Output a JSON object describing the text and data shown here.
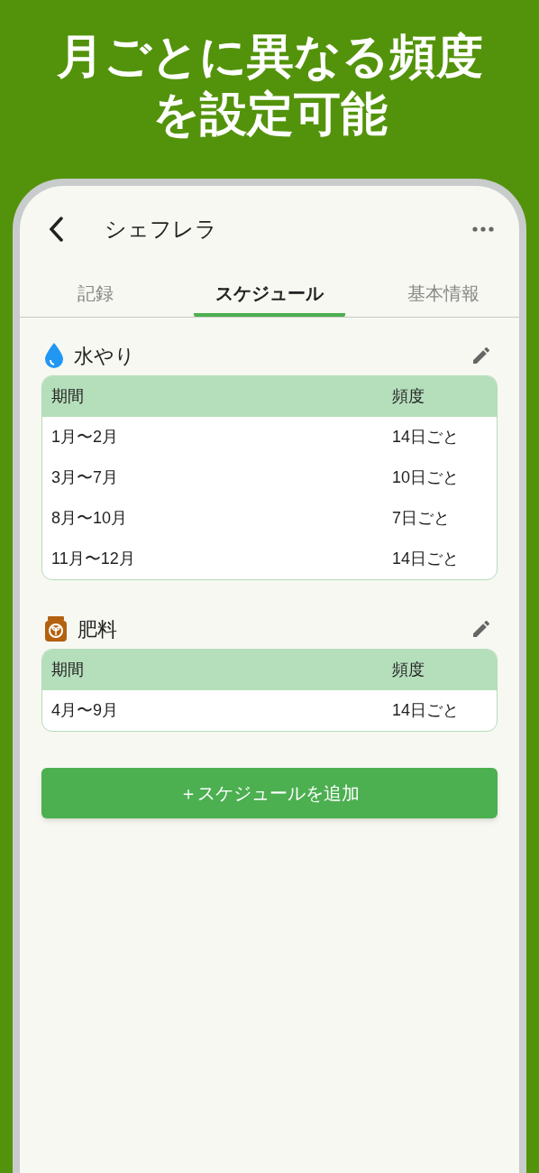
{
  "headline": [
    "月ごとに異なる頻度",
    "を設定可能"
  ],
  "app_bar": {
    "title": "シェフレラ"
  },
  "tabs": [
    {
      "label": "記録",
      "selected": false
    },
    {
      "label": "スケジュール",
      "selected": true
    },
    {
      "label": "基本情報",
      "selected": false
    }
  ],
  "sections": [
    {
      "kind": "water",
      "title": "水やり",
      "columns": [
        "期間",
        "頻度"
      ],
      "rows": [
        [
          "1月〜2月",
          "14日ごと"
        ],
        [
          "3月〜7月",
          "10日ごと"
        ],
        [
          "8月〜10月",
          "7日ごと"
        ],
        [
          "11月〜12月",
          "14日ごと"
        ]
      ]
    },
    {
      "kind": "fertilizer",
      "title": "肥料",
      "columns": [
        "期間",
        "頻度"
      ],
      "rows": [
        [
          "4月〜9月",
          "14日ごと"
        ]
      ]
    }
  ],
  "add_button": "＋スケジュールを追加"
}
